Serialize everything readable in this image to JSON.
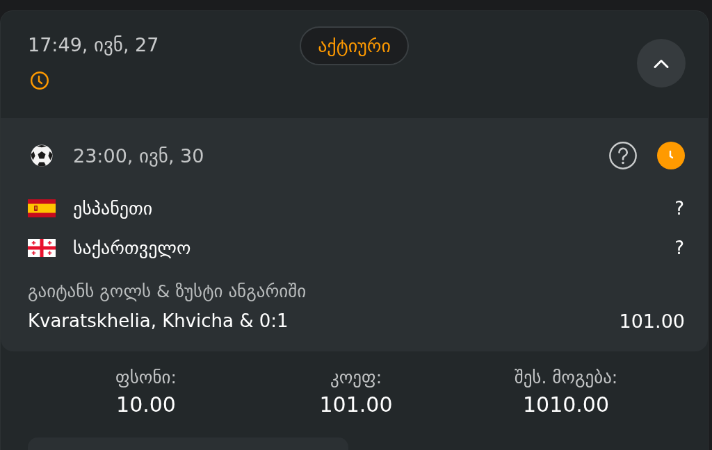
{
  "header": {
    "datetime": "17:49, ივნ, 27",
    "status": "აქტიური",
    "expanded": true
  },
  "event": {
    "datetime": "23:00, ივნ, 30",
    "teams": [
      {
        "kind": "spain",
        "name": "ესპანეთი",
        "score": "?"
      },
      {
        "kind": "georgia",
        "name": "საქართველო",
        "score": "?"
      }
    ],
    "market": "გაიტანს გოლს & ზუსტი ანგარიში",
    "selection": "Kvaratskhelia, Khvicha & 0:1",
    "odds": "101.00"
  },
  "summary": [
    {
      "label": "ფსონი:",
      "value": "10.00"
    },
    {
      "label": "კოეფ:",
      "value": "101.00"
    },
    {
      "label": "შეს. მოგება:",
      "value": "1010.00"
    }
  ]
}
